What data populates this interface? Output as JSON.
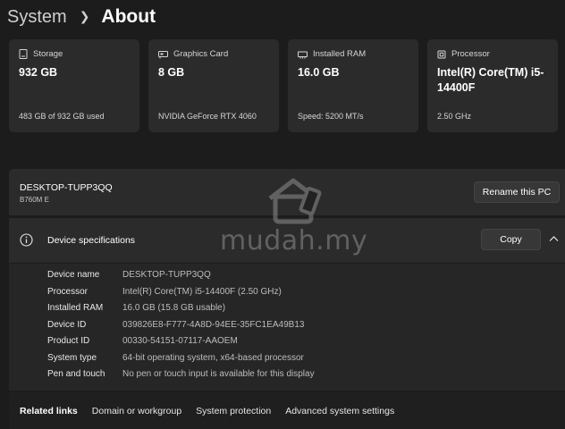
{
  "breadcrumb": {
    "parent": "System",
    "current": "About"
  },
  "cards": [
    {
      "label": "Storage",
      "value": "932 GB",
      "sub": "483 GB of 932 GB used",
      "icon": "storage-icon"
    },
    {
      "label": "Graphics Card",
      "value": "8 GB",
      "sub": "NVIDIA GeForce RTX 4060",
      "icon": "graphics-card-icon"
    },
    {
      "label": "Installed RAM",
      "value": "16.0 GB",
      "sub": "Speed: 5200 MT/s",
      "icon": "ram-icon"
    },
    {
      "label": "Processor",
      "value": "Intel(R) Core(TM) i5-14400F",
      "sub": "2.50 GHz",
      "icon": "processor-icon"
    }
  ],
  "device": {
    "name": "DESKTOP-TUPP3QQ",
    "model": "B760M E",
    "rename_label": "Rename this PC"
  },
  "specs": {
    "title": "Device specifications",
    "copy_label": "Copy",
    "rows": [
      {
        "key": "Device name",
        "value": "DESKTOP-TUPP3QQ"
      },
      {
        "key": "Processor",
        "value": "Intel(R) Core(TM) i5-14400F (2.50 GHz)"
      },
      {
        "key": "Installed RAM",
        "value": "16.0 GB (15.8 GB usable)"
      },
      {
        "key": "Device ID",
        "value": "039826E8-F777-4A8D-94EE-35FC1EA49B13"
      },
      {
        "key": "Product ID",
        "value": "00330-54151-07117-AAOEM"
      },
      {
        "key": "System type",
        "value": "64-bit operating system, x64-based processor"
      },
      {
        "key": "Pen and touch",
        "value": "No pen or touch input is available for this display"
      }
    ]
  },
  "related": {
    "title": "Related links",
    "links": [
      "Domain or workgroup",
      "System protection",
      "Advanced system settings"
    ]
  },
  "watermark": {
    "text": "mudah.my"
  }
}
